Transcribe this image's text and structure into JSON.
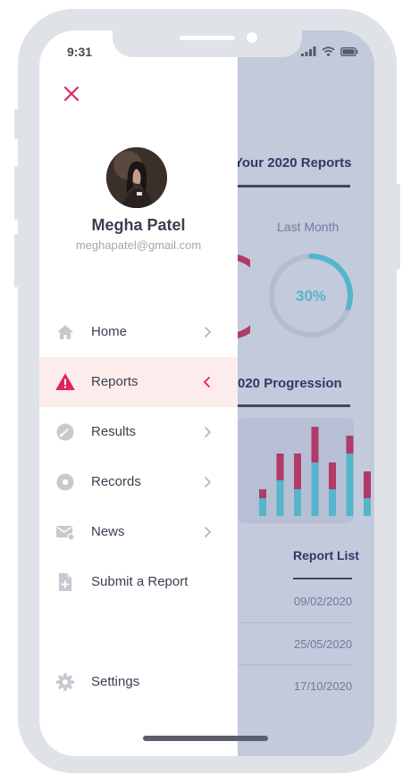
{
  "status_bar": {
    "time": "9:31"
  },
  "drawer": {
    "user": {
      "name": "Megha Patel",
      "email": "meghapatel@gmail.com"
    },
    "items": [
      {
        "label": "Home",
        "icon": "home-icon",
        "active": false,
        "chevron": "right"
      },
      {
        "label": "Reports",
        "icon": "warning-icon",
        "active": true,
        "chevron": "left"
      },
      {
        "label": "Results",
        "icon": "gauge-icon",
        "active": false,
        "chevron": "right"
      },
      {
        "label": "Records",
        "icon": "disc-icon",
        "active": false,
        "chevron": "right"
      },
      {
        "label": "News",
        "icon": "mail-icon",
        "active": false,
        "chevron": "right"
      },
      {
        "label": "Submit a Report",
        "icon": "add-document-icon",
        "active": false,
        "chevron": ""
      }
    ],
    "settings_label": "Settings"
  },
  "background": {
    "reports_title": "Your 2020 Reports",
    "last_month_label": "Last Month",
    "last_month_value": "30%",
    "last_month_fraction": 0.3,
    "progression_title": "020 Progression",
    "report_list_title": "Report List",
    "report_dates": [
      "09/02/2020",
      "25/05/2020",
      "17/10/2020"
    ]
  },
  "chart_data": {
    "type": "bar",
    "series": [
      {
        "values": [
          2,
          4,
          3,
          6,
          3,
          7,
          2
        ]
      },
      {
        "values": [
          1,
          3,
          4,
          4,
          3,
          2,
          3
        ]
      }
    ]
  },
  "colors": {
    "accent": "#e0245e",
    "active_bg": "#fdecec",
    "icon_gray": "#c5c9d0",
    "chart_blue": "#55b6cb",
    "chart_red": "#b03a68",
    "overlay": "#c2cadc"
  }
}
